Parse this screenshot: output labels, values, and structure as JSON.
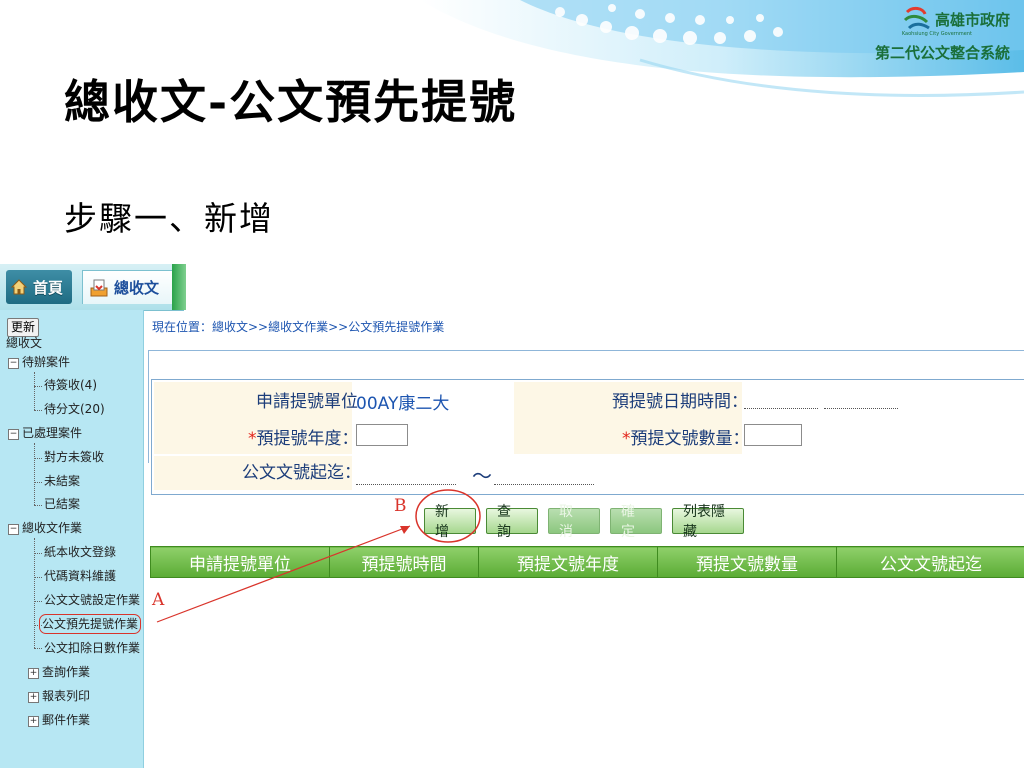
{
  "slide": {
    "title": "總收文-公文預先提號",
    "subtitle": "步驟一、新增"
  },
  "logo": {
    "city": "高雄市政府",
    "english": "Kaohsiung City Government",
    "system": "第二代公文整合系統"
  },
  "tabs": {
    "home": "首頁",
    "receive": "總收文"
  },
  "sidebar": {
    "update_button": "更新",
    "root": "總收文",
    "groups": [
      {
        "label": "待辦案件",
        "toggle": "−",
        "items": [
          "待簽收(4)",
          "待分文(20)"
        ]
      },
      {
        "label": "已處理案件",
        "toggle": "−",
        "items": [
          "對方未簽收",
          "未結案",
          "已結案"
        ]
      },
      {
        "label": "總收文作業",
        "toggle": "−",
        "items": [
          "紙本收文登錄",
          "代碼資料維護",
          "公文文號設定作業",
          "公文預先提號作業",
          "公文扣除日數作業"
        ]
      },
      {
        "label": "查詢作業",
        "toggle": "+",
        "items": []
      },
      {
        "label": "報表列印",
        "toggle": "+",
        "items": []
      },
      {
        "label": "郵件作業",
        "toggle": "+",
        "items": []
      }
    ]
  },
  "main": {
    "breadcrumb": "現在位置：總收文>>總收文作業>>公文預先提號作業",
    "form": {
      "unit_label": "申請提號單位",
      "unit_value": "00AY康二大",
      "datetime_label": "預提號日期時間：",
      "year_label": "預提號年度：",
      "count_label": "預提文號數量：",
      "range_label": "公文文號起迄：",
      "range_sep": "～",
      "required_mark": "*"
    },
    "buttons": {
      "new": "新增",
      "query": "查詢",
      "cancel": "取消",
      "confirm": "確定",
      "hide_list": "列表隱藏"
    },
    "table_headers": [
      "申請提號單位",
      "預提號時間",
      "預提文號年度",
      "預提文號數量",
      "公文文號起迄"
    ]
  },
  "annotations": {
    "a": "A",
    "b": "B"
  },
  "colors": {
    "annotation": "#d9342b",
    "table_header": "#5aab34",
    "sidebar": "#b7e7f3",
    "link": "#1d55b0"
  }
}
